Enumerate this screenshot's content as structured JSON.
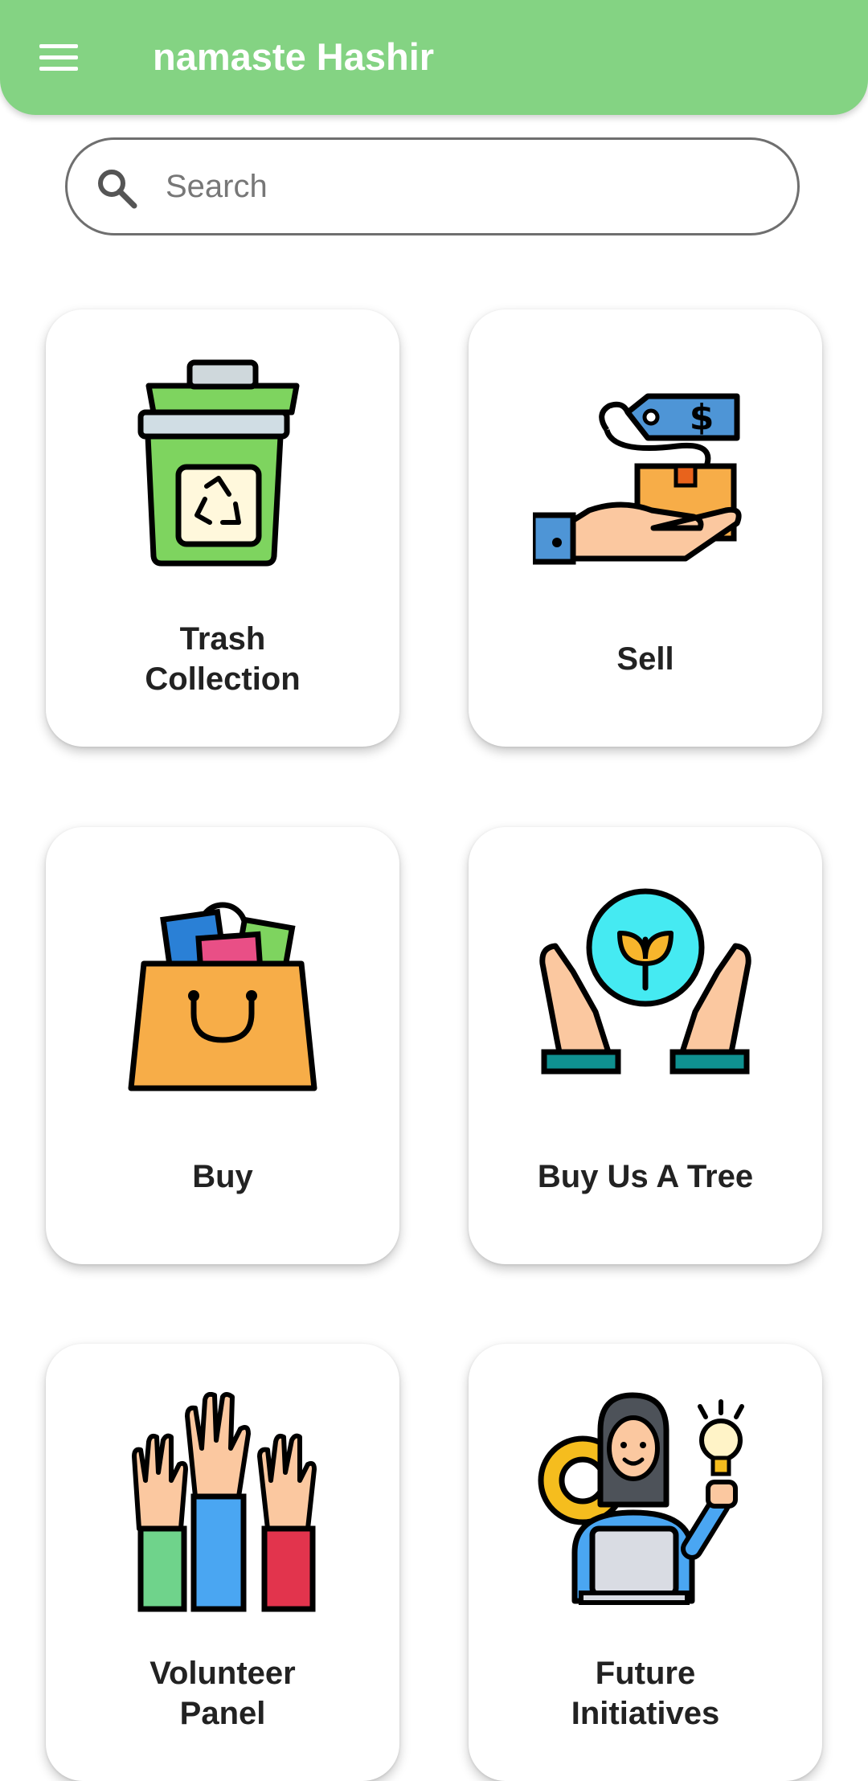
{
  "header": {
    "title": "namaste Hashir",
    "menu_icon": "menu-icon",
    "bar_color": "#84d383"
  },
  "search": {
    "placeholder": "Search",
    "value": "",
    "icon": "search-icon"
  },
  "tiles": [
    {
      "label": "Trash Collection",
      "icon": "trash-bin-icon"
    },
    {
      "label": "Sell",
      "icon": "hand-box-price-tag-icon"
    },
    {
      "label": "Buy",
      "icon": "shopping-bag-icon"
    },
    {
      "label": "Buy Us A Tree",
      "icon": "hands-globe-plant-icon"
    },
    {
      "label": "Volunteer Panel",
      "icon": "raised-hands-icon"
    },
    {
      "label": "Future Initiatives",
      "icon": "woman-laptop-idea-icon"
    }
  ]
}
